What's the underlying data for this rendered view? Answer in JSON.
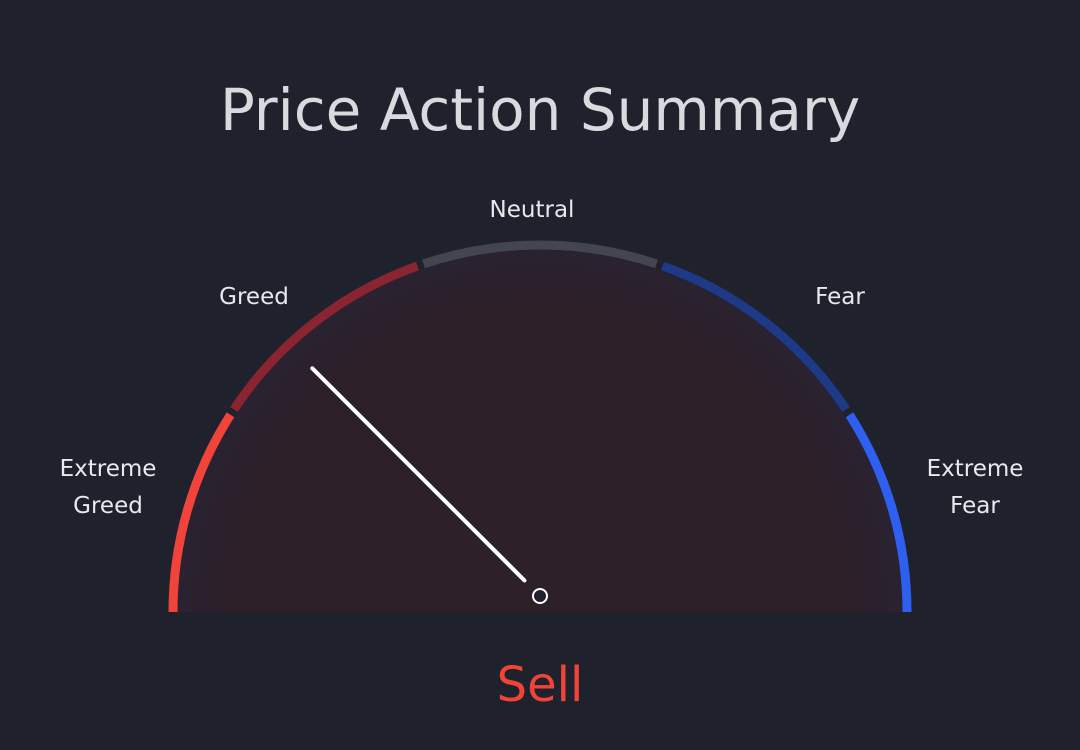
{
  "title": "Price Action Summary",
  "gauge": {
    "labels": {
      "extreme_greed": [
        "Extreme",
        "Greed"
      ],
      "greed": "Greed",
      "neutral": "Neutral",
      "fear": "Fear",
      "extreme_fear": [
        "Extreme",
        "Fear"
      ]
    },
    "verdict": "Sell",
    "colors": {
      "extreme_greed": "#f0443a",
      "greed": "#8a2430",
      "neutral": "#44464f",
      "fear": "#1e3a86",
      "extreme_fear": "#2f5ff0",
      "verdict": "#f04438",
      "needle": "#ffffff"
    }
  },
  "chart_data": {
    "type": "gauge",
    "title": "Price Action Summary",
    "segments": [
      "Extreme Greed",
      "Greed",
      "Neutral",
      "Fear",
      "Extreme Fear"
    ],
    "value_label": "Sell",
    "needle_position": 0.25
  }
}
